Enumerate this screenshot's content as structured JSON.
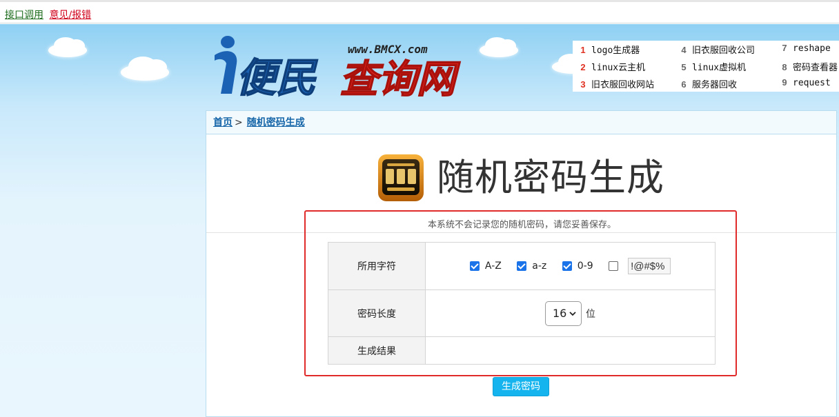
{
  "topbar": {
    "api_link": "接口调用",
    "report_link": "意见/报错"
  },
  "logo": {
    "url_text": "www.BMCX.com",
    "brand_part1": "便民",
    "brand_part2": "查询网"
  },
  "hot_links": [
    {
      "num": "1",
      "label": "logo生成器"
    },
    {
      "num": "2",
      "label": "linux云主机"
    },
    {
      "num": "3",
      "label": "旧衣服回收网站"
    },
    {
      "num": "4",
      "label": "旧衣服回收公司"
    },
    {
      "num": "5",
      "label": "linux虚拟机"
    },
    {
      "num": "6",
      "label": "服务器回收"
    },
    {
      "num": "7",
      "label": "reshape"
    },
    {
      "num": "8",
      "label": "密码查看器"
    },
    {
      "num": "9",
      "label": "request"
    }
  ],
  "breadcrumb": {
    "home": "首页",
    "sep": ">",
    "current": "随机密码生成"
  },
  "page": {
    "title": "随机密码生成",
    "notice": "本系统不会记录您的随机密码，请您妥善保存。"
  },
  "form": {
    "chars_label": "所用字符",
    "options": [
      {
        "label": "A-Z",
        "checked": true
      },
      {
        "label": "a-z",
        "checked": true
      },
      {
        "label": "0-9",
        "checked": true
      }
    ],
    "special_value": "!@#$%",
    "special_checked": false,
    "length_label": "密码长度",
    "length_value": "16",
    "length_unit": "位",
    "result_label": "生成结果",
    "result_value": ""
  },
  "generate_button": "生成密码",
  "colors": {
    "accent_blue": "#15b4ee",
    "link_blue": "#1565a8",
    "annotation_red": "#e02a2a",
    "hot_red": "#e03021"
  }
}
